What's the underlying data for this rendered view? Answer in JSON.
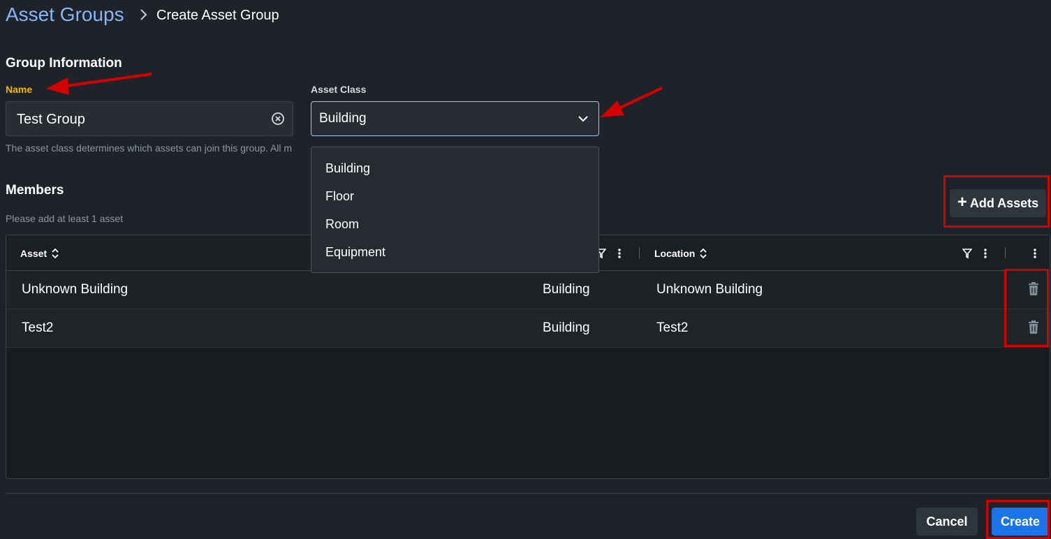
{
  "breadcrumb": {
    "root": "Asset Groups",
    "current": "Create Asset Group"
  },
  "group_info": {
    "title": "Group Information",
    "name_label": "Name",
    "name_value": "Test Group",
    "asset_class_label": "Asset Class",
    "asset_class_value": "Building",
    "helper_text": "The asset class determines which assets can join this group. All m"
  },
  "asset_class_menu": {
    "options": [
      "Building",
      "Floor",
      "Room",
      "Equipment"
    ]
  },
  "members": {
    "title": "Members",
    "hint": "Please add at least 1 asset",
    "add_button": "Add Assets",
    "columns": [
      "Asset",
      "Location"
    ],
    "rows": [
      {
        "asset": "Unknown Building",
        "class": "Building",
        "location": "Unknown Building"
      },
      {
        "asset": "Test2",
        "class": "Building",
        "location": "Test2"
      }
    ]
  },
  "footer": {
    "cancel": "Cancel",
    "create": "Create"
  },
  "colors": {
    "background": "#1d2329",
    "accent": "#1a73e8",
    "breadcrumb_link": "#8ab4f8",
    "name_label": "#f5b800",
    "annotation": "#d50000"
  },
  "icons": {
    "breadcrumb_separator": "chevron-right-icon",
    "clear": "clear-circle-icon",
    "dropdown": "chevron-down-icon",
    "add": "plus-icon",
    "sort": "sort-icon",
    "filter": "filter-icon",
    "column_menu": "more-vertical-icon",
    "delete": "trash-icon"
  }
}
